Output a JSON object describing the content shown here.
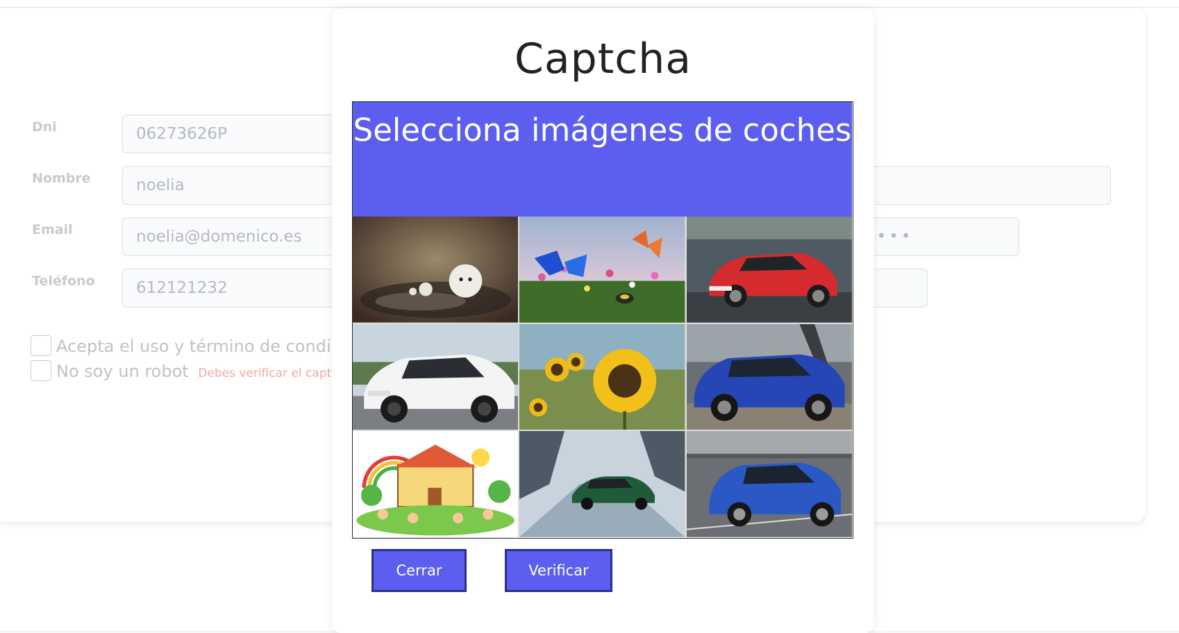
{
  "form": {
    "fields": [
      {
        "label": "Dni",
        "value": "06273626P"
      },
      {
        "label": "Nombre",
        "value": "noelia"
      },
      {
        "label": "Email",
        "value": "noelia@domenico.es"
      },
      {
        "label": "Teléfono",
        "value": "612121232"
      }
    ],
    "right_password_value": "••••••",
    "checkbox_terms_label": "Acepta el uso y término de condic",
    "checkbox_robot_label": "No soy un robot",
    "robot_error": "Debes verificar el capta"
  },
  "modal": {
    "title": "Captcha",
    "instruction": "Selecciona imágenes de coches",
    "tiles": [
      {
        "icon": "puddle-figures-image"
      },
      {
        "icon": "butterflies-flowers-image"
      },
      {
        "icon": "red-car-image"
      },
      {
        "icon": "white-car-image"
      },
      {
        "icon": "sunflowers-image"
      },
      {
        "icon": "blue-suv-image"
      },
      {
        "icon": "school-cartoon-image"
      },
      {
        "icon": "green-car-snow-image"
      },
      {
        "icon": "blue-suv-parking-image"
      }
    ],
    "close_label": "Cerrar",
    "verify_label": "Verificar"
  },
  "colors": {
    "accent": "#5b5eef",
    "button_border": "#2c2f8a",
    "error": "#f1a8a8"
  }
}
